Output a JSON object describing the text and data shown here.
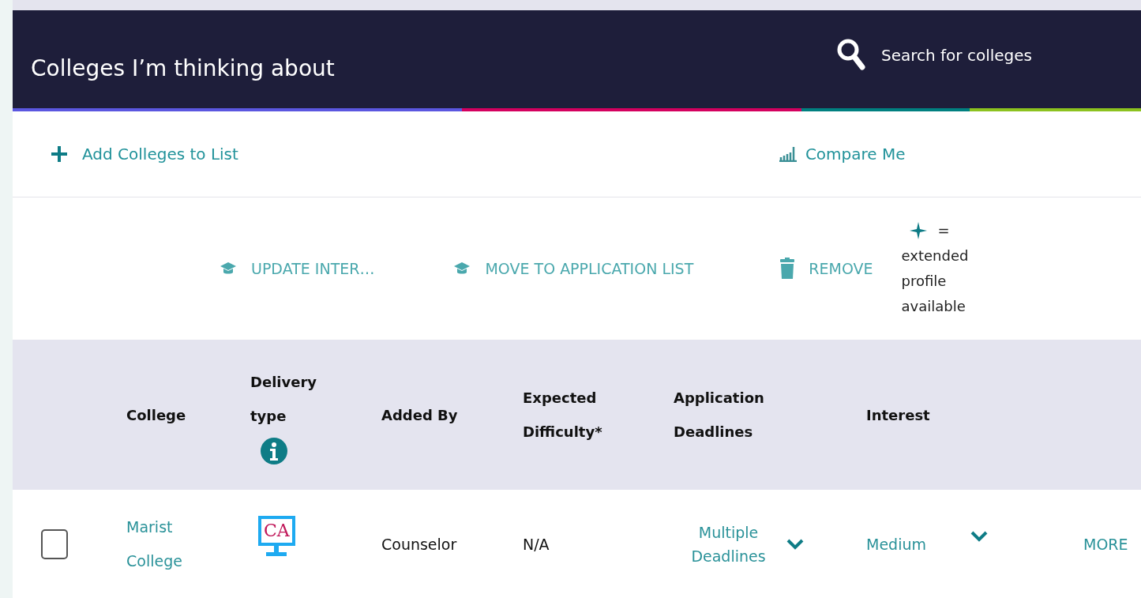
{
  "header": {
    "title": "Colleges I’m thinking about",
    "search": "Search for colleges"
  },
  "toolbar": [
    {
      "kind": "add",
      "label": "Add Colleges to List"
    },
    {
      "kind": "compare",
      "label": "Compare Me"
    }
  ],
  "actions": [
    {
      "kind": "cap",
      "label": "UPDATE INTER…"
    },
    {
      "kind": "cap",
      "label": "MOVE TO APPLICATION LIST"
    },
    {
      "kind": "trash",
      "label": "REMOVE"
    }
  ],
  "legend": {
    "symbol": "=",
    "text": "extended profile available"
  },
  "table": {
    "columns": [
      {
        "lines": [
          "College"
        ]
      },
      {
        "lines": [
          "Delivery",
          "type"
        ],
        "info": true
      },
      {
        "lines": [
          "Added By"
        ]
      },
      {
        "lines": [
          "Expected",
          "Difficulty*"
        ]
      },
      {
        "lines": [
          "Application",
          "Deadlines"
        ]
      },
      {
        "lines": [
          "Interest"
        ]
      }
    ],
    "rows": [
      {
        "checked": false,
        "college": "Marist College",
        "delivery": "CA",
        "added_by": "Counselor",
        "difficulty": "N/A",
        "deadlines": "Multiple Deadlines",
        "interest": "Medium",
        "more": "MORE"
      }
    ]
  }
}
